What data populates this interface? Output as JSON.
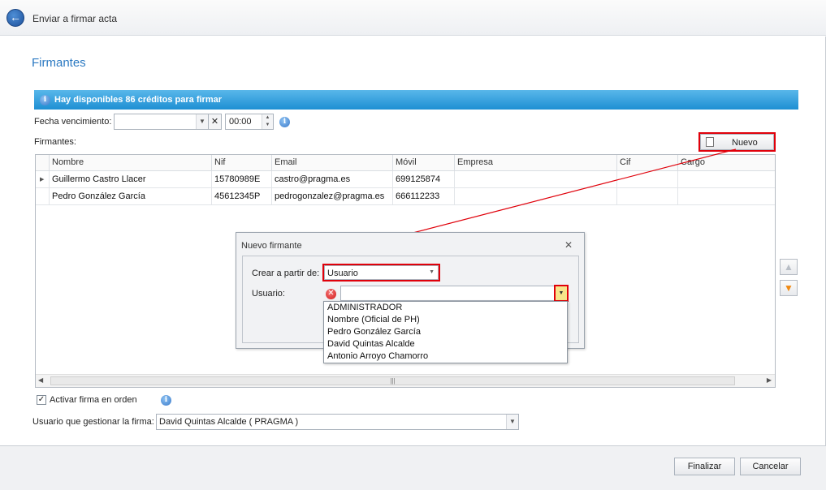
{
  "window": {
    "title": "Enviar a firmar acta"
  },
  "section": {
    "title": "Firmantes"
  },
  "info_bar": {
    "text": "Hay disponibles 86 créditos para firmar"
  },
  "expiration": {
    "label": "Fecha vencimiento:",
    "date_value": "",
    "time_value": "00:00"
  },
  "signers": {
    "label": "Firmantes:",
    "new_button": "Nuevo",
    "columns": [
      "Nombre",
      "Nif",
      "Email",
      "Móvil",
      "Empresa",
      "Cif",
      "Cargo"
    ],
    "rows": [
      [
        "Guillermo Castro Llacer",
        "15780989E",
        "castro@pragma.es",
        "699125874",
        "",
        "",
        ""
      ],
      [
        "Pedro González García",
        "45612345P",
        "pedrogonzalez@pragma.es",
        "666112233",
        "",
        "",
        ""
      ]
    ]
  },
  "dialog": {
    "title": "Nuevo firmante",
    "create_from_label": "Crear a partir de:",
    "create_from_value": "Usuario",
    "user_label": "Usuario:",
    "user_value": "",
    "options": [
      "ADMINISTRADOR",
      "Nombre (Oficial de PH)",
      "Pedro González García",
      "David Quintas Alcalde",
      "Antonio Arroyo Chamorro"
    ]
  },
  "order": {
    "label": "Activar firma en orden",
    "checked": true
  },
  "manager": {
    "label": "Usuario que gestionar la firma:",
    "value": "David Quintas Alcalde ( PRAGMA )"
  },
  "footer": {
    "finish_button": "Finalizar",
    "cancel_button": "Cancelar"
  },
  "colors": {
    "accent": "#2b79c2",
    "info_bar": "#1e8fd3",
    "highlight": "#e0000a"
  }
}
